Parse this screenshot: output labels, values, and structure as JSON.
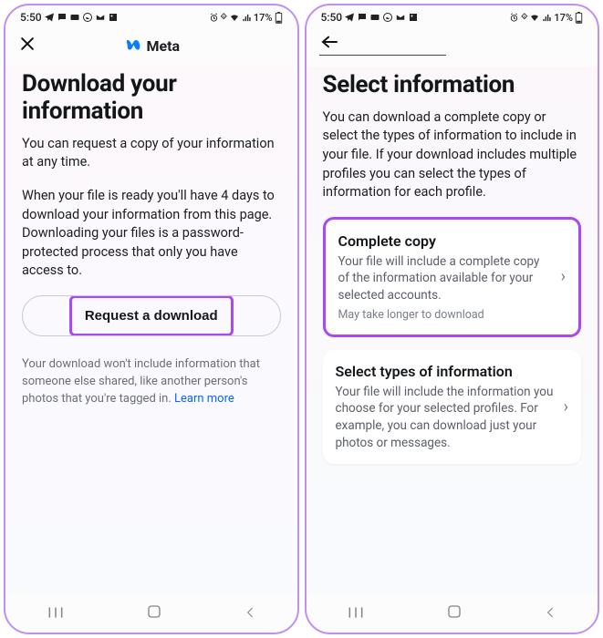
{
  "status": {
    "time": "5:50",
    "battery_text": "17%"
  },
  "screen1": {
    "brand": "Meta",
    "title": "Download your information",
    "para1": "You can request a copy of your information at any time.",
    "para2": "When your file is ready you'll have 4 days to download your information from this page. Downloading your files is a password-protected process that only you have access to.",
    "button_label": "Request a download",
    "foot_text": "Your download won't include information that someone else shared, like another person's photos that you're tagged in. ",
    "learn_more": "Learn more"
  },
  "screen2": {
    "title": "Select information",
    "intro": "You can download a complete copy or select the types of information to include in your file. If your download includes multiple profiles you can select the types of information for each profile.",
    "option1": {
      "title": "Complete copy",
      "sub": "Your file will include a complete copy of the information available for your selected accounts.",
      "note": "May take longer to download"
    },
    "option2": {
      "title": "Select types of information",
      "sub": "Your file will include the information you choose for your selected profiles. For example, you can download just your photos or messages."
    }
  }
}
